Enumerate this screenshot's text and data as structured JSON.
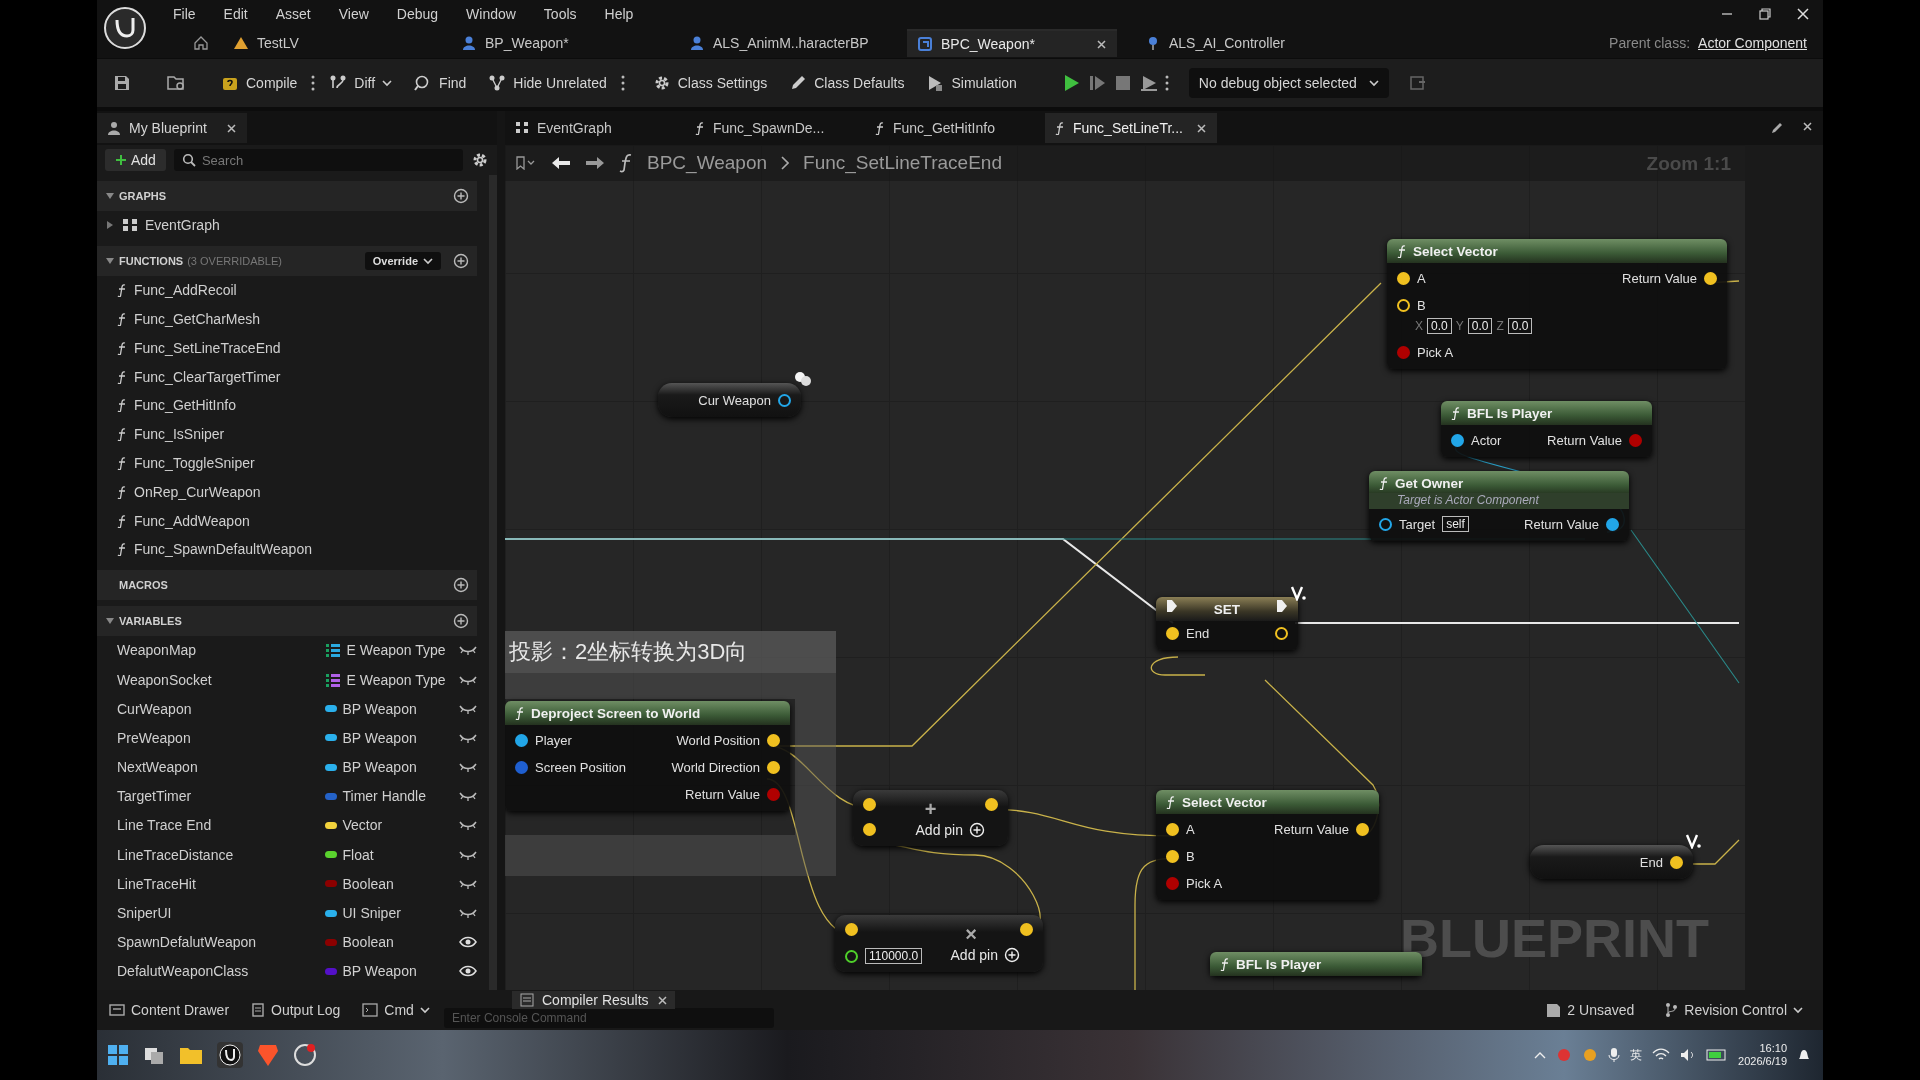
{
  "menu": [
    "File",
    "Edit",
    "Asset",
    "View",
    "Debug",
    "Window",
    "Tools",
    "Help"
  ],
  "doc_tabs": [
    {
      "label": "TestLV",
      "selected": false
    },
    {
      "label": "BP_Weapon*",
      "selected": false
    },
    {
      "label": "ALS_AnimM..haracterBP",
      "selected": false
    },
    {
      "label": "BPC_Weapon*",
      "selected": true
    },
    {
      "label": "ALS_AI_Controller",
      "selected": false
    }
  ],
  "parent_class": {
    "label": "Parent class:",
    "value": "Actor Component"
  },
  "toolbar": {
    "buttons": [
      {
        "label": "Compile"
      },
      {
        "label": "Diff"
      },
      {
        "label": "Find"
      },
      {
        "label": "Hide Unrelated"
      },
      {
        "label": "Class Settings"
      },
      {
        "label": "Class Defaults"
      },
      {
        "label": "Simulation"
      }
    ],
    "debug_select": "No debug object selected"
  },
  "my_blueprint": {
    "title": "My Blueprint",
    "add": "Add",
    "search_placeholder": "Search",
    "sections": [
      {
        "kind": "graphs",
        "title": "GRAPHS",
        "items": [
          {
            "label": "EventGraph",
            "expanded": false
          }
        ]
      },
      {
        "kind": "functions",
        "title": "FUNCTIONS",
        "note": "(3 OVERRIDABLE)",
        "override": "Override",
        "items": [
          {
            "label": "Func_AddRecoil"
          },
          {
            "label": "Func_GetCharMesh"
          },
          {
            "label": "Func_SetLineTraceEnd"
          },
          {
            "label": "Func_ClearTargetTimer"
          },
          {
            "label": "Func_GetHitInfo"
          },
          {
            "label": "Func_IsSniper"
          },
          {
            "label": "Func_ToggleSniper"
          },
          {
            "label": "OnRep_CurWeapon"
          },
          {
            "label": "Func_AddWeapon"
          },
          {
            "label": "Func_SpawnDefaultWeapon"
          }
        ]
      },
      {
        "kind": "macros",
        "title": "MACROS"
      },
      {
        "kind": "variables",
        "title": "VARIABLES",
        "items": [
          {
            "name": "WeaponMap",
            "type": "E Weapon Type",
            "kind": "map",
            "color": "#2aa9e0",
            "public": false
          },
          {
            "name": "WeaponSocket",
            "type": "E Weapon Type",
            "kind": "map",
            "color": "#b060e8",
            "public": false
          },
          {
            "name": "CurWeapon",
            "type": "BP Weapon",
            "kind": "single",
            "color": "#2ab0ec",
            "public": false
          },
          {
            "name": "PreWeapon",
            "type": "BP Weapon",
            "kind": "single",
            "color": "#2ab0ec",
            "public": false
          },
          {
            "name": "NextWeapon",
            "type": "BP Weapon",
            "kind": "single",
            "color": "#2ab0ec",
            "public": false
          },
          {
            "name": "TargetTimer",
            "type": "Timer Handle",
            "kind": "single",
            "color": "#2462c8",
            "public": false
          },
          {
            "name": "Line Trace End",
            "type": "Vector",
            "kind": "single",
            "color": "#f2d23c",
            "public": false
          },
          {
            "name": "LineTraceDistance",
            "type": "Float",
            "kind": "single",
            "color": "#5ad22e",
            "public": false
          },
          {
            "name": "LineTraceHit",
            "type": "Boolean",
            "kind": "single",
            "color": "#8c0000",
            "public": false
          },
          {
            "name": "SniperUI",
            "type": "UI Sniper",
            "kind": "single",
            "color": "#2ab0ec",
            "public": false
          },
          {
            "name": "SpawnDefalutWeapon",
            "type": "Boolean",
            "kind": "single",
            "color": "#8c0000",
            "public": true
          },
          {
            "name": "DefalutWeaponClass",
            "type": "BP Weapon",
            "kind": "single",
            "color": "#5410c8",
            "public": true
          }
        ]
      }
    ]
  },
  "graph_tabs": [
    {
      "label": "EventGraph",
      "selected": false
    },
    {
      "label": "Func_SpawnDe...",
      "selected": false
    },
    {
      "label": "Func_GetHitInfo",
      "selected": false
    },
    {
      "label": "Func_SetLineTr...",
      "selected": true
    }
  ],
  "breadcrumb": [
    "BPC_Weapon",
    "Func_SetLineTraceEnd"
  ],
  "zoom_label": "Zoom 1:1",
  "graph": {
    "comment": {
      "title": "投影：2坐标转换为3D向"
    },
    "watermark": "BLUEPRINT",
    "nodes": [
      {
        "kind": "function",
        "title": "Select Vector",
        "rows": [
          {
            "in": {
              "label": "A",
              "color": "#f0c020",
              "connected": true
            },
            "out": {
              "label": "Return Value",
              "color": "#f0c020",
              "connected": true
            }
          },
          {
            "in": {
              "label": "B",
              "color": "#f0c020",
              "connected": false,
              "fields": [
                {
                  "axis": "X",
                  "value": "0.0"
                },
                {
                  "axis": "Y",
                  "value": "0.0"
                },
                {
                  "axis": "Z",
                  "value": "0.0"
                }
              ]
            }
          },
          {
            "in": {
              "label": "Pick A",
              "color": "#b00000",
              "connected": true
            }
          }
        ]
      },
      {
        "kind": "function",
        "title": "BFL Is Player",
        "rows": [
          {
            "in": {
              "label": "Actor",
              "color": "#22a6e8",
              "connected": true
            },
            "out": {
              "label": "Return Value",
              "color": "#b00000",
              "connected": true
            }
          }
        ]
      },
      {
        "kind": "function",
        "title": "Get Owner",
        "subtitle": "Target is Actor Component",
        "rows": [
          {
            "in": {
              "label": "Target",
              "color": "#22a6e8",
              "connected": false,
              "value": "self"
            },
            "out": {
              "label": "Return Value",
              "color": "#22a6e8",
              "connected": true
            }
          }
        ]
      },
      {
        "kind": "getter",
        "replicated": true,
        "rows": [
          {
            "out": {
              "label": "Cur Weapon",
              "color": "#22a6e8",
              "connected": false
            }
          }
        ]
      },
      {
        "kind": "set",
        "title": "SET",
        "variable_marker": true,
        "rows": [
          {
            "in": {
              "label": "End",
              "color": "#f0c020",
              "connected": true
            },
            "out": {
              "color": "#f0c020",
              "connected": false
            }
          }
        ]
      },
      {
        "kind": "function",
        "title": "Deproject Screen to World",
        "rows": [
          {
            "in": {
              "label": "Player",
              "color": "#22a6e8",
              "connected": true
            },
            "out": {
              "label": "World Position",
              "color": "#f0c020",
              "connected": true
            }
          },
          {
            "in": {
              "label": "Screen Position",
              "color": "#1f5fd0",
              "connected": true
            },
            "out": {
              "label": "World Direction",
              "color": "#f0c020",
              "connected": true
            }
          },
          {
            "out": {
              "label": "Return Value",
              "color": "#b00000",
              "connected": true
            }
          }
        ]
      },
      {
        "kind": "math",
        "symbol": "+",
        "add_pin": "Add pin",
        "rows": [
          {
            "in": {
              "color": "#f0c020",
              "connected": true
            },
            "out": {
              "color": "#f0c020",
              "connected": true
            }
          },
          {
            "in": {
              "color": "#f0c020",
              "connected": true
            }
          }
        ]
      },
      {
        "kind": "math",
        "symbol": "×",
        "add_pin": "Add pin",
        "rows": [
          {
            "in": {
              "color": "#f0c020",
              "connected": true
            },
            "out": {
              "color": "#f0c020",
              "connected": true
            }
          },
          {
            "in": {
              "color": "#4fd02a",
              "connected": false,
              "value": "110000.0"
            }
          }
        ]
      },
      {
        "kind": "function",
        "title": "Select Vector",
        "rows": [
          {
            "in": {
              "label": "A",
              "color": "#f0c020",
              "connected": true
            },
            "out": {
              "label": "Return Value",
              "color": "#f0c020",
              "connected": true
            }
          },
          {
            "in": {
              "label": "B",
              "color": "#f0c020",
              "connected": true
            }
          },
          {
            "in": {
              "label": "Pick A",
              "color": "#b00000",
              "connected": true
            }
          }
        ]
      },
      {
        "kind": "function",
        "title": "BFL Is Player"
      },
      {
        "kind": "getter",
        "variable_marker": true,
        "rows": [
          {
            "out": {
              "label": "End",
              "color": "#f0c020",
              "connected": true
            }
          }
        ]
      }
    ]
  },
  "status_bar": {
    "left": [
      "Content Drawer",
      "Output Log"
    ],
    "cmd": "Cmd",
    "console_placeholder": "Enter Console Command",
    "floating_tab": "Compiler Results",
    "unsaved": "2 Unsaved",
    "revision": "Revision Control"
  },
  "taskbar": {
    "ime": "英",
    "time": "16:10",
    "date": "2026/6/19"
  }
}
